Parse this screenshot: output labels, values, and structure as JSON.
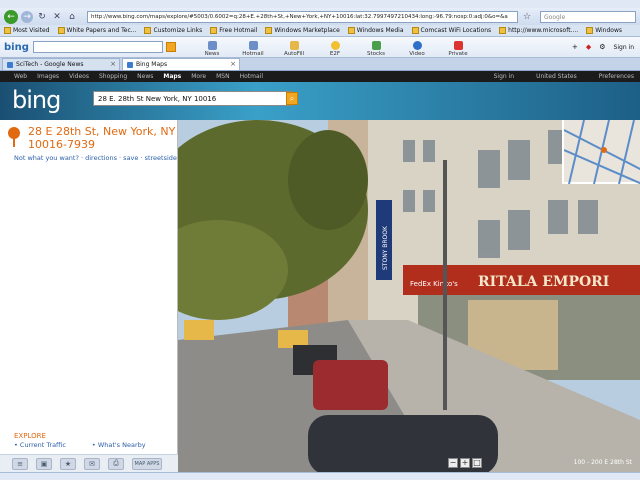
{
  "browser": {
    "address_url": "http://www.bing.com/maps/explore/#5003/0.6002=q:28+E.+28th+St,+New+York,+NY+10016:lat:32.7997497210434:long:-96.79:nosp:0:adj:0&o=&a",
    "search_placeholder": "Google",
    "bookmarks": [
      "Most Visited",
      "White Papers and Tec...",
      "Customize Links",
      "Free Hotmail",
      "Windows Marketplace",
      "Windows Media",
      "Comcast WiFi Locations",
      "http://www.microsoft....",
      "Windows"
    ],
    "bingbar": {
      "logo": "bing",
      "buttons": [
        "News",
        "Hotmail",
        "AutoFill",
        "E2F",
        "Stocks",
        "Video",
        "Private"
      ],
      "signin": "Sign in"
    },
    "tabs": [
      {
        "title": "SciTech - Google News"
      },
      {
        "title": "Bing Maps"
      }
    ]
  },
  "bing": {
    "nav": [
      "Web",
      "Images",
      "Videos",
      "Shopping",
      "News",
      "Maps",
      "More",
      "MSN",
      "Hotmail"
    ],
    "nav_right": [
      "Sign in",
      "United States",
      "Preferences"
    ],
    "logo": "bing",
    "search_value": "28 E. 28th St  New York, NY 10016"
  },
  "location": {
    "address_line1": "28 E 28th St, New York, NY",
    "address_line2": "10016-7939",
    "links": "Not what you want? · directions · save · streetside"
  },
  "explore": {
    "title": "EXPLORE",
    "links": [
      "• Current Traffic",
      "• What's Nearby"
    ]
  },
  "tools": {
    "apps_label": "MAP APPS"
  },
  "streetside": {
    "scale": "100 - 200 E 28th St",
    "signs": {
      "store": "RITALA EMPORI",
      "fedex": "FedEx Kinko's",
      "banner": "STONY BROOK"
    }
  }
}
